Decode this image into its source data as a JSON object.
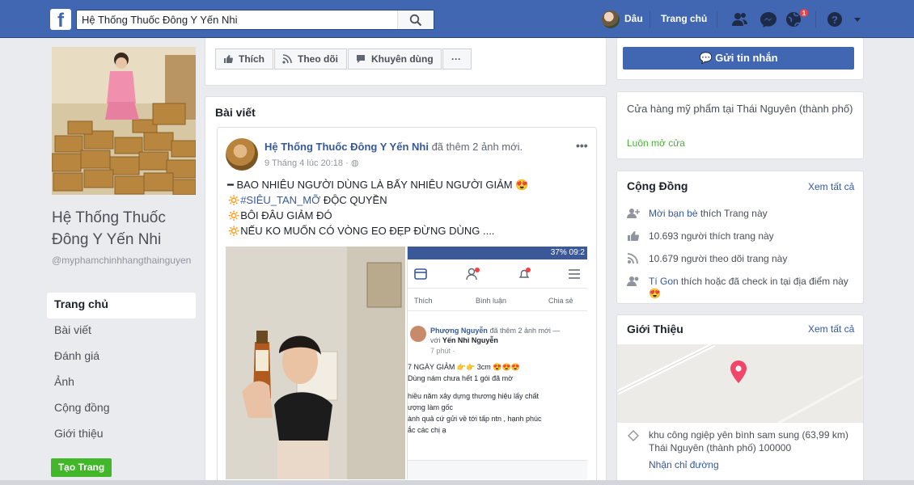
{
  "topbar": {
    "search_value": "Hệ Thống Thuốc Đông Y Yến Nhi",
    "user_name": "Dâu",
    "home_label": "Trang chủ",
    "notification_count": "1"
  },
  "page": {
    "name": "Hệ Thống Thuốc Đông Y Yến Nhi",
    "username": "@myphamchinhhangthainguyen"
  },
  "left_nav": {
    "items": [
      {
        "label": "Trang chủ"
      },
      {
        "label": "Bài viết"
      },
      {
        "label": "Đánh giá"
      },
      {
        "label": "Ảnh"
      },
      {
        "label": "Cộng đồng"
      },
      {
        "label": "Giới thiệu"
      }
    ],
    "create_page": "Tạo Trang"
  },
  "actions": {
    "like": "Thích",
    "follow": "Theo dõi",
    "recommend": "Khuyên dùng",
    "more": "···"
  },
  "posts_section": {
    "title": "Bài viết",
    "post": {
      "author": "Hệ Thống Thuốc Đông Y Yến Nhi",
      "action": "đã thêm 2 ảnh mới.",
      "time": "9 Tháng 4 lúc 20:18 · ",
      "lines": [
        "━ BAO NHIÊU NGƯỜI DÙNG LÀ BẤY NHIÊU NGƯỜI GIẢM 😍",
        "#SIÊU_TAN_MỠ",
        " ĐỘC QUYỀN",
        "BÔI ĐÂU GIẢM ĐÓ",
        "NẾU KO MUỐN CÓ VÒNG EO ĐẸP ĐỪNG DÙNG ...."
      ],
      "screenshot": {
        "status": "37% 09:2",
        "like": "Thích",
        "comment": "Bình luận",
        "share": "Chia sẻ",
        "author": "Phượng Nguyễn",
        "action": "đã thêm 2 ảnh mới — với",
        "tagged": "Yến Nhi Nguyễn",
        "time": "7 phút · ",
        "line1": "7 NGÀY GIẢM 👉👉 3cm 😍😍😍",
        "line2": "Dùng nám chưa hết 1 gói đã mờ",
        "line3": "hiều năm xây dựng thương hiệu lấy chất",
        "line4": "ượng làm gốc",
        "line5": "ành quả cứ gửi về tới tấp ntn , hạnh phúc",
        "line6": "ắc các chị ạ"
      }
    }
  },
  "right": {
    "send_message": "Gửi tin nhắn",
    "category": "Cửa hàng mỹ phẩm tại Thái Nguyên (thành phố)",
    "open_status": "Luôn mở cửa",
    "community": {
      "title": "Cộng Đồng",
      "see_all": "Xem tất cả",
      "invite_link": "Mời bạn bè",
      "invite_rest": " thích Trang này",
      "likes": "10.693 người thích trang này",
      "follows": "10.679 người theo dõi trang này",
      "checkin_name": "Tí Gon",
      "checkin_rest": " thích hoặc đã check in tại địa điểm này"
    },
    "about": {
      "title": "Giới Thiệu",
      "see_all": "Xem tất cả",
      "address": "khu công ngiệp yên bình sam sung (63,99 km) Thái Nguyên (thành phố) 100000",
      "directions": "Nhận chỉ đường"
    }
  }
}
